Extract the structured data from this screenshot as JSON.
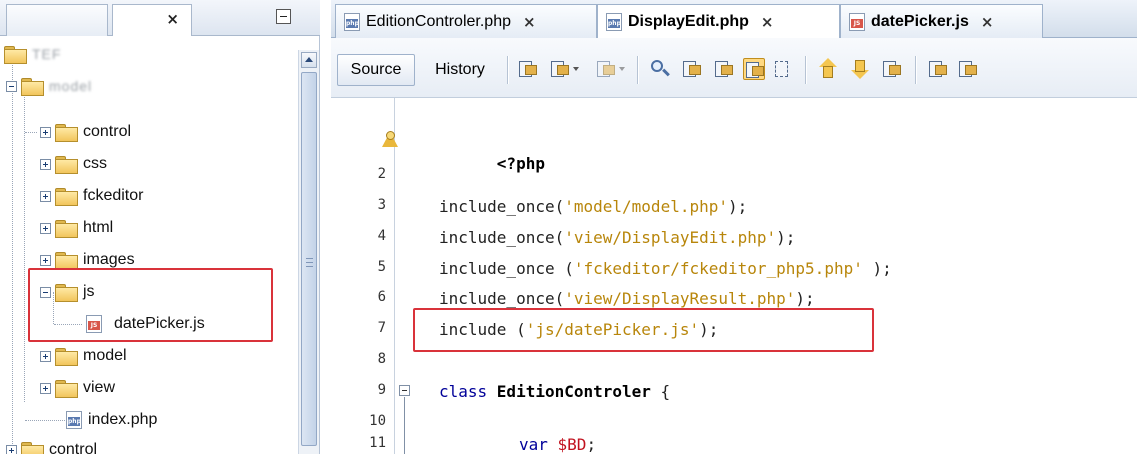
{
  "left_panel": {
    "tab_close": "×",
    "tree": [
      {
        "label": "TEF",
        "blurred": true
      },
      {
        "label": "model",
        "blurred": true
      },
      {
        "label": "control"
      },
      {
        "label": "css"
      },
      {
        "label": "fckeditor"
      },
      {
        "label": "html"
      },
      {
        "label": "images"
      },
      {
        "label": "js"
      },
      {
        "label": "datePicker.js"
      },
      {
        "label": "model"
      },
      {
        "label": "view"
      },
      {
        "label": "index.php"
      },
      {
        "label": "control"
      }
    ]
  },
  "editor": {
    "tabs": [
      {
        "title": "EditionControler.php",
        "close": "×",
        "icon": "php-file-icon"
      },
      {
        "title": "DisplayEdit.php",
        "close": "×",
        "icon": "php-file-icon"
      },
      {
        "title": "datePicker.js",
        "close": "×",
        "icon": "js-file-icon"
      }
    ],
    "toolbar": {
      "source_label": "Source",
      "history_label": "History"
    },
    "line_numbers": [
      "2",
      "3",
      "4",
      "5",
      "6",
      "7",
      "8",
      "9",
      "10",
      "11"
    ],
    "code": {
      "l1": "<?php",
      "l3_fn": "include_once(",
      "l3_str": "'model/model.php'",
      "l3_end": ");",
      "l4_fn": "include_once(",
      "l4_str": "'view/DisplayEdit.php'",
      "l4_end": ");",
      "l5_fn": "include_once (",
      "l5_str": "'fckeditor/fckeditor_php5.php'",
      "l5_end": " );",
      "l6_fn": "include_once(",
      "l6_str": "'view/DisplayResult.php'",
      "l6_end": ");",
      "l7_fn": "include (",
      "l7_str": "'js/datePicker.js'",
      "l7_end": ");",
      "l9_kw": "class ",
      "l9_name": "EditionControler",
      "l9_end": " {",
      "l11_kw": "var ",
      "l11_var": "$BD",
      "l11_end": ";"
    }
  },
  "colors": {
    "highlight_box": "#d9323a",
    "keyword": "#000099",
    "string": "#b8860b"
  }
}
